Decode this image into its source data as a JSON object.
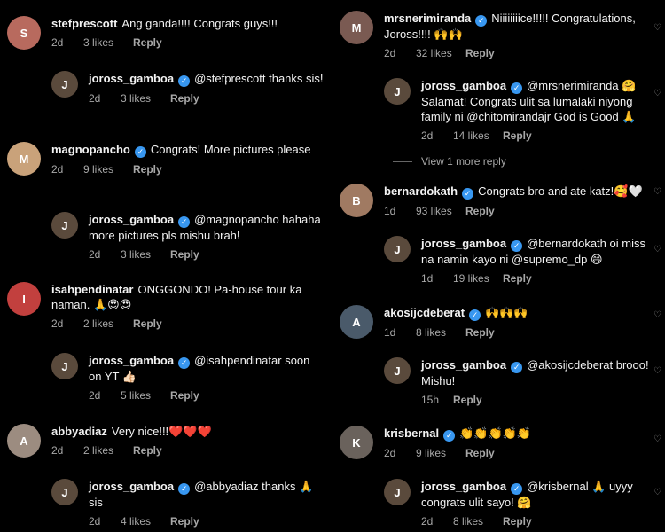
{
  "colors": {
    "background": "#000000",
    "verified": "#3897f0",
    "meta": "#a8a8a8"
  },
  "left": [
    {
      "user": "stefprescott",
      "verified": false,
      "text": "Ang ganda!!!! Congrats guys!!!",
      "time": "2d",
      "likes": "3 likes",
      "reply": "Reply"
    },
    {
      "user": "joross_gamboa",
      "verified": true,
      "text": "@stefprescott thanks sis!",
      "time": "2d",
      "likes": "3 likes",
      "reply": "Reply"
    },
    {
      "user": "magnopancho",
      "verified": true,
      "text": "Congrats! More pictures please",
      "time": "2d",
      "likes": "9 likes",
      "reply": "Reply"
    },
    {
      "user": "joross_gamboa",
      "verified": true,
      "text": "@magnopancho hahaha more pictures pls mishu brah!",
      "time": "2d",
      "likes": "3 likes",
      "reply": "Reply"
    },
    {
      "user": "isahpendinatar",
      "verified": false,
      "text": "ONGGONDO! Pa-house tour ka naman. 🙏😍😍",
      "time": "2d",
      "likes": "2 likes",
      "reply": "Reply"
    },
    {
      "user": "joross_gamboa",
      "verified": true,
      "text": "@isahpendinatar soon on YT 👍🏻",
      "time": "2d",
      "likes": "5 likes",
      "reply": "Reply"
    },
    {
      "user": "abbyadiaz",
      "verified": false,
      "text": "Very nice!!!❤️❤️❤️",
      "time": "2d",
      "likes": "2 likes",
      "reply": "Reply"
    },
    {
      "user": "joross_gamboa",
      "verified": true,
      "text": "@abbyadiaz thanks 🙏 sis",
      "time": "2d",
      "likes": "4 likes",
      "reply": "Reply"
    }
  ],
  "right": [
    {
      "user": "mrsnerimiranda",
      "verified": true,
      "text": "Niiiiiiiice!!!!! Congratulations, Joross!!!! 🙌🙌",
      "time": "2d",
      "likes": "32 likes",
      "reply": "Reply"
    },
    {
      "user": "joross_gamboa",
      "verified": true,
      "text": "@mrsnerimiranda 🤗 Salamat! Congrats ulit sa lumalaki niyong family ni @chitomirandajr God is Good 🙏",
      "time": "2d",
      "likes": "14 likes",
      "reply": "Reply"
    },
    {
      "user": "bernardokath",
      "verified": true,
      "text": "Congrats bro and ate katz!🥰🤍",
      "time": "1d",
      "likes": "93 likes",
      "reply": "Reply"
    },
    {
      "user": "joross_gamboa",
      "verified": true,
      "text": "@bernardokath oi miss na namin kayo ni @supremo_dp 😄",
      "time": "1d",
      "likes": "19 likes",
      "reply": "Reply"
    },
    {
      "user": "akosijcdeberat",
      "verified": true,
      "text": "🙌🙌🙌",
      "time": "1d",
      "likes": "8 likes",
      "reply": "Reply"
    },
    {
      "user": "joross_gamboa",
      "verified": true,
      "text": "@akosijcdeberat brooo! Mishu!",
      "time": "15h",
      "likes": "",
      "reply": "Reply"
    },
    {
      "user": "krisbernal",
      "verified": true,
      "text": "👏👏👏👏👏",
      "time": "2d",
      "likes": "9 likes",
      "reply": "Reply"
    },
    {
      "user": "joross_gamboa",
      "verified": true,
      "text": "@krisbernal 🙏 uyyy congrats ulit sayo! 🤗",
      "time": "2d",
      "likes": "8 likes",
      "reply": "Reply"
    }
  ],
  "view_more": "View 1 more reply"
}
